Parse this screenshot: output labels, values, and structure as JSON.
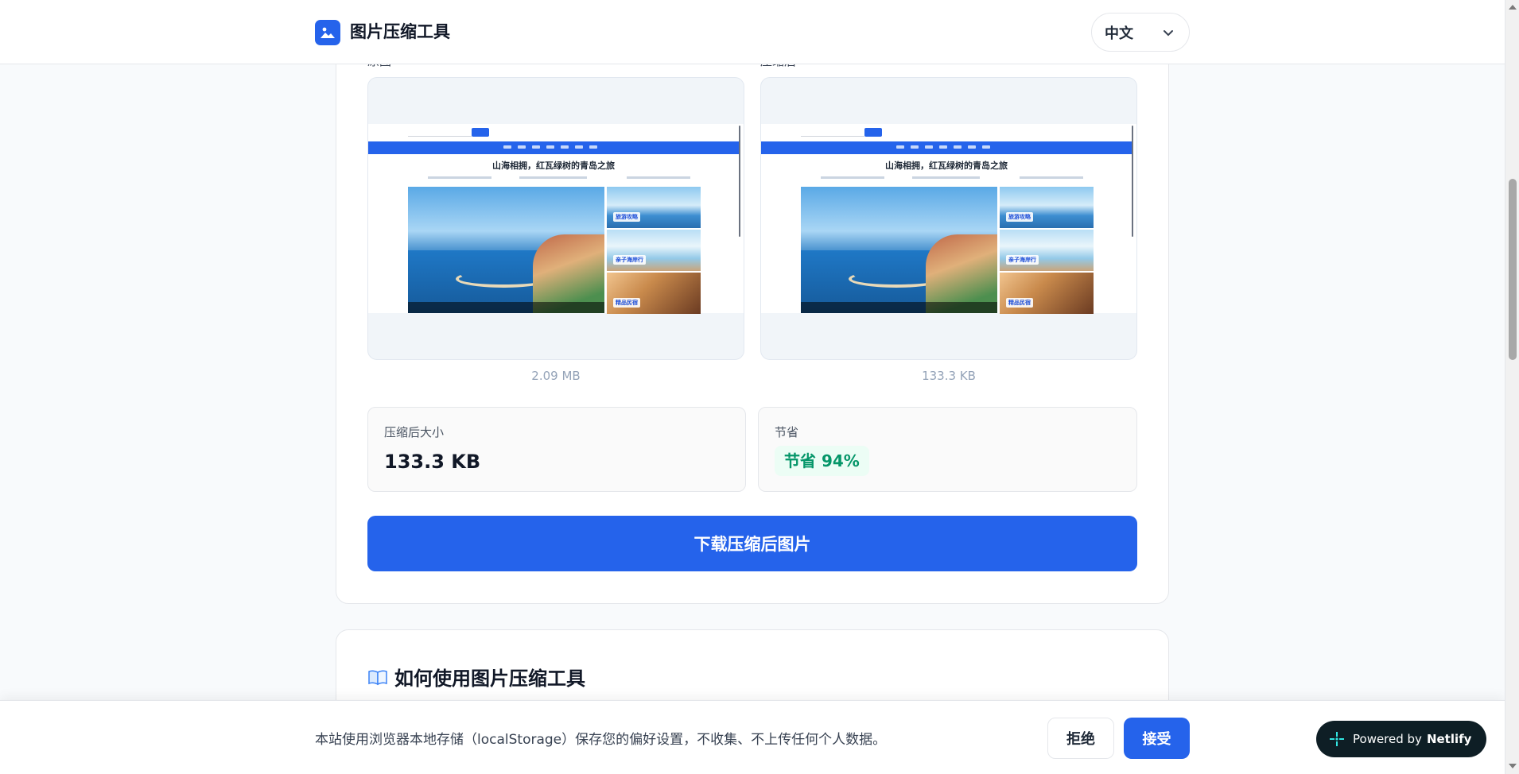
{
  "header": {
    "app_title": "图片压缩工具",
    "language": "中文"
  },
  "preview": {
    "original_label": "原图",
    "compressed_label": "压缩后",
    "original_size": "2.09 MB",
    "compressed_size": "133.3 KB",
    "screenshot_headline": "山海相拥，红瓦绿树的青岛之旅",
    "thumb_tags": [
      "旅游攻略",
      "亲子海岸行",
      "精品民宿"
    ]
  },
  "stats": {
    "compressed_size_label": "压缩后大小",
    "compressed_size_value": "133.3 KB",
    "savings_label": "节省",
    "savings_value": "节省 94%"
  },
  "download_button": "下载压缩后图片",
  "howto": {
    "title": "如何使用图片压缩工具"
  },
  "cookie": {
    "text": "本站使用浏览器本地存储（localStorage）保存您的偏好设置，不收集、不上传任何个人数据。",
    "reject": "拒绝",
    "accept": "接受"
  },
  "netlify": {
    "prefix": "Powered by",
    "brand": "Netlify"
  },
  "colors": {
    "accent": "#2563eb",
    "success": "#059669",
    "netlify_bg": "#0e1e25"
  }
}
